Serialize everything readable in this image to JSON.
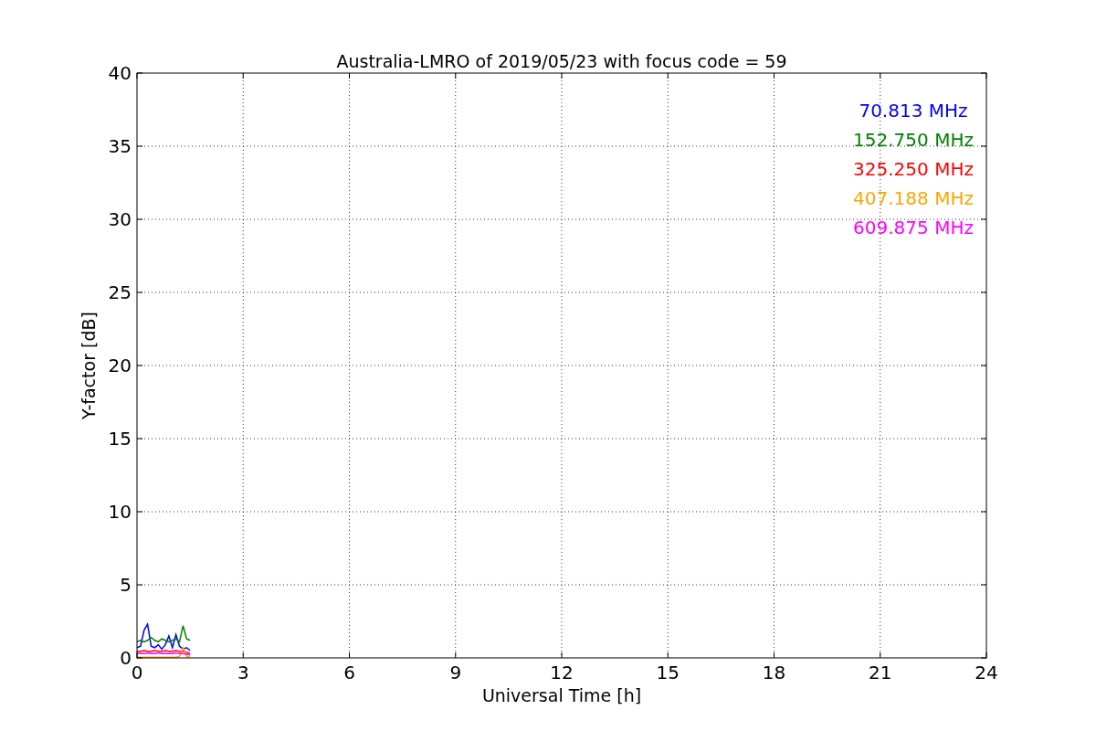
{
  "chart_data": {
    "type": "line",
    "title": "Australia-LMRO of 2019/05/23 with focus code = 59",
    "xlabel": "Universal Time [h]",
    "ylabel": "Y-factor [dB]",
    "x": [
      0,
      0.1,
      0.2,
      0.3,
      0.4,
      0.5,
      0.6,
      0.7,
      0.8,
      0.9,
      1.0,
      1.1,
      1.2,
      1.3,
      1.4,
      1.5
    ],
    "series": [
      {
        "name": "70.813 MHz",
        "color": "#0000ff",
        "values": [
          0.7,
          0.8,
          1.9,
          2.3,
          0.8,
          0.7,
          0.9,
          0.6,
          0.9,
          1.5,
          0.7,
          1.6,
          0.8,
          0.6,
          0.7,
          0.5
        ]
      },
      {
        "name": "152.750 MHz",
        "color": "#008000",
        "values": [
          1.1,
          1.2,
          1.1,
          1.2,
          1.4,
          1.2,
          1.1,
          1.3,
          1.2,
          1.1,
          1.2,
          1.3,
          1.1,
          2.2,
          1.3,
          1.2
        ]
      },
      {
        "name": "325.250 MHz",
        "color": "#ff0000",
        "values": [
          0.45,
          0.45,
          0.5,
          0.45,
          0.45,
          0.5,
          0.45,
          0.45,
          0.5,
          0.45,
          0.45,
          0.5,
          0.45,
          0.45,
          0.4,
          0.3
        ]
      },
      {
        "name": "407.188 MHz",
        "color": "#ffa500",
        "values": [
          0.05,
          0.05,
          0.05,
          0.05,
          0.05,
          0.05,
          0.05,
          0.05,
          0.05,
          0.05,
          0.05,
          0.05,
          0.1,
          0.7,
          0.1,
          0.05
        ]
      },
      {
        "name": "609.875 MHz",
        "color": "#ff00ff",
        "values": [
          0.35,
          0.3,
          0.3,
          0.35,
          0.3,
          0.3,
          0.35,
          0.3,
          0.3,
          0.3,
          0.3,
          0.35,
          0.3,
          0.3,
          0.25,
          0.2
        ]
      }
    ],
    "grid": true,
    "xlim": [
      0,
      24
    ],
    "ylim": [
      0,
      40
    ],
    "xticks": [
      0,
      3,
      6,
      9,
      12,
      15,
      18,
      21,
      24
    ],
    "yticks": [
      0,
      5,
      10,
      15,
      20,
      25,
      30,
      35,
      40
    ]
  }
}
